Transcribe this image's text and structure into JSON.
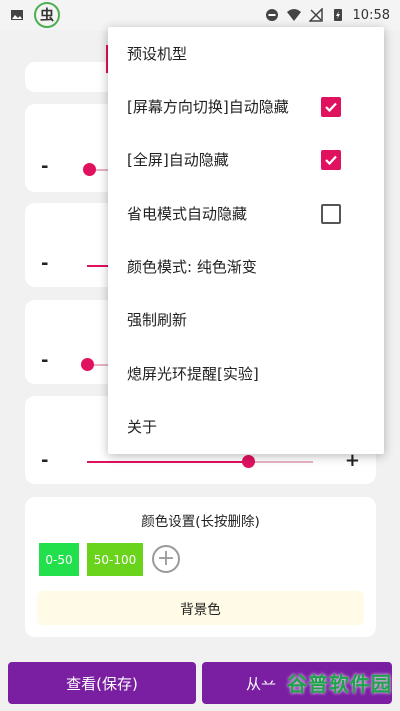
{
  "status_bar": {
    "time": "10:58"
  },
  "app_glyph": "虫",
  "sliders": [
    {
      "minus": "-",
      "plus": "+",
      "value": 0.02
    },
    {
      "minus": "-",
      "plus": "+",
      "value": 0.0
    },
    {
      "minus": "-",
      "plus": "+",
      "value": 0.0
    },
    {
      "minus": "-",
      "plus": "+",
      "value": 0.71
    }
  ],
  "color_settings": {
    "title": "颜色设置(长按删除)",
    "swatches": [
      {
        "label": "0-50",
        "color": "#22e04c"
      },
      {
        "label": "50-100",
        "color": "#6ad41c"
      }
    ],
    "add_symbol": "+",
    "background_label": "背景色"
  },
  "buttons": {
    "view_save": "查看(保存)",
    "second_partial": "从䒑"
  },
  "watermark": "谷普软件园",
  "menu": {
    "items": [
      {
        "label": "预设机型"
      },
      {
        "label": "[屏幕方向切换]自动隐藏",
        "checked": true
      },
      {
        "label": "[全屏]自动隐藏",
        "checked": true
      },
      {
        "label": "省电模式自动隐藏",
        "checked": false
      },
      {
        "label": "颜色模式: 纯色渐变"
      },
      {
        "label": "强制刷新"
      },
      {
        "label": "熄屏光环提醒[实验]"
      },
      {
        "label": "关于"
      }
    ]
  },
  "colors": {
    "accent": "#e0115f",
    "primary": "#7b1fa2"
  }
}
